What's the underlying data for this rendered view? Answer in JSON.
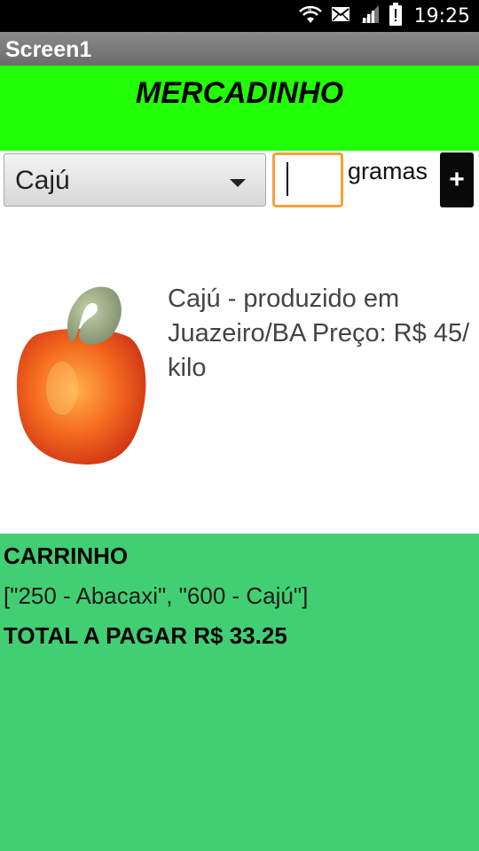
{
  "status_bar": {
    "time": "19:25",
    "icons": [
      "wifi-icon",
      "mail-icon",
      "signal-icon",
      "battery-alert-icon"
    ]
  },
  "title_bar": {
    "title": "Screen1"
  },
  "header": {
    "title": "MERCADINHO",
    "color": "#23ff06"
  },
  "controls": {
    "product_select": {
      "selected": "Cajú"
    },
    "quantity_input": {
      "value": ""
    },
    "unit_label": "gramas",
    "add_button_label": "+",
    "input_focus_color": "#f2a33a"
  },
  "product": {
    "image": "cashew-fruit-image",
    "description": "Cajú - produzido em Juazeiro/BA  Preço: R$ 45/ kilo"
  },
  "cart": {
    "title": "CARRINHO",
    "items_text": "[\"250 - Abacaxi\", \"600 - Cajú\"]",
    "total_text": "TOTAL A PAGAR R$ 33.25",
    "color": "#42cf73"
  }
}
